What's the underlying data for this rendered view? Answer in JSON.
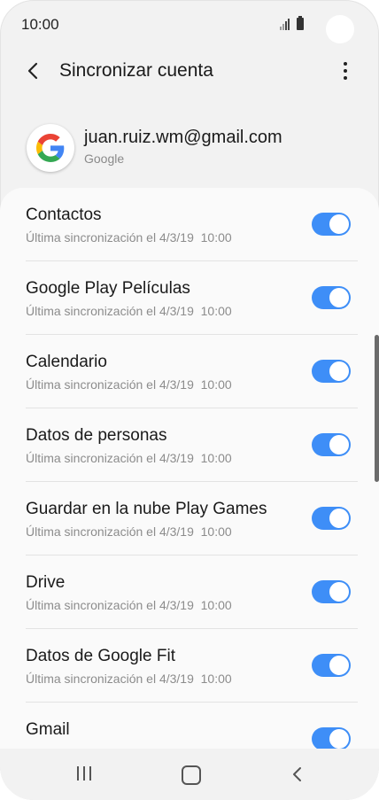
{
  "status_bar": {
    "time": "10:00"
  },
  "toolbar": {
    "title": "Sincronizar cuenta"
  },
  "account": {
    "email": "juan.ruiz.wm@gmail.com",
    "provider": "Google"
  },
  "colors": {
    "accent": "#3e8ef7"
  },
  "sync_items": [
    {
      "title": "Contactos",
      "subtitle": "Última sincronización el 4/3/19  10:00",
      "enabled": true
    },
    {
      "title": "Google Play Películas",
      "subtitle": "Última sincronización el 4/3/19  10:00",
      "enabled": true
    },
    {
      "title": "Calendario",
      "subtitle": "Última sincronización el 4/3/19  10:00",
      "enabled": true
    },
    {
      "title": "Datos de personas",
      "subtitle": "Última sincronización el 4/3/19  10:00",
      "enabled": true
    },
    {
      "title": "Guardar en la nube Play Games",
      "subtitle": "Última sincronización el 4/3/19  10:00",
      "enabled": true
    },
    {
      "title": "Drive",
      "subtitle": "Última sincronización el 4/3/19  10:00",
      "enabled": true
    },
    {
      "title": "Datos de Google Fit",
      "subtitle": "Última sincronización el 4/3/19  10:00",
      "enabled": true
    },
    {
      "title": "Gmail",
      "subtitle": "",
      "enabled": true
    }
  ],
  "icons": {
    "back": "back-arrow-icon",
    "more": "more-vert-icon",
    "logo": "google-logo-icon",
    "nav_recents": "recents-icon",
    "nav_home": "home-icon",
    "nav_back": "nav-back-icon"
  }
}
